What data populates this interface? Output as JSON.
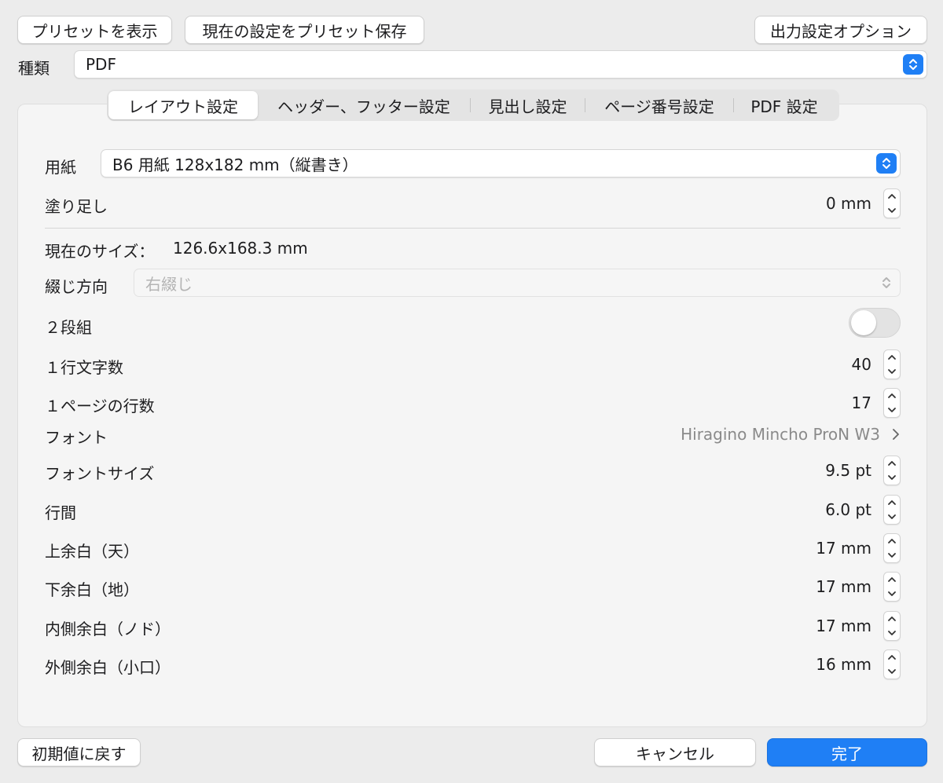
{
  "top_bar": {
    "show_presets": "プリセットを表示",
    "save_preset": "現在の設定をプリセット保存",
    "output_options": "出力設定オプション"
  },
  "type_row": {
    "label": "種類",
    "value": "PDF"
  },
  "tabs": [
    {
      "label": "レイアウト設定",
      "active": true
    },
    {
      "label": "ヘッダー、フッター設定",
      "active": false
    },
    {
      "label": "見出し設定",
      "active": false
    },
    {
      "label": "ページ番号設定",
      "active": false
    },
    {
      "label": "PDF 設定",
      "active": false
    }
  ],
  "layout": {
    "paper": {
      "label": "用紙",
      "value": "B6 用紙 128x182 mm（縦書き）"
    },
    "bleed": {
      "label": "塗り足し",
      "value": "0 mm"
    },
    "current_size": {
      "label": "現在のサイズ：",
      "value": "126.6x168.3 mm"
    },
    "binding": {
      "label": "綴じ方向",
      "value": "右綴じ",
      "disabled": true
    },
    "two_columns": {
      "label": "２段組",
      "on": false
    },
    "chars_per_line": {
      "label": "１行文字数",
      "value": "40"
    },
    "lines_per_page": {
      "label": "１ページの行数",
      "value": "17"
    },
    "font": {
      "label": "フォント",
      "value": "Hiragino Mincho ProN W3"
    },
    "font_size": {
      "label": "フォントサイズ",
      "value": "9.5 pt"
    },
    "line_spacing": {
      "label": "行間",
      "value": "6.0 pt"
    },
    "margin_top": {
      "label": "上余白（天）",
      "value": "17 mm"
    },
    "margin_bottom": {
      "label": "下余白（地）",
      "value": "17 mm"
    },
    "margin_inner": {
      "label": "内側余白（ノド）",
      "value": "17 mm"
    },
    "margin_outer": {
      "label": "外側余白（小口）",
      "value": "16 mm"
    }
  },
  "bottom_bar": {
    "reset": "初期値に戻す",
    "cancel": "キャンセル",
    "done": "完了"
  },
  "colors": {
    "accent": "#1f7ff5",
    "panel": "#f5f5f5",
    "background": "#ececec"
  }
}
